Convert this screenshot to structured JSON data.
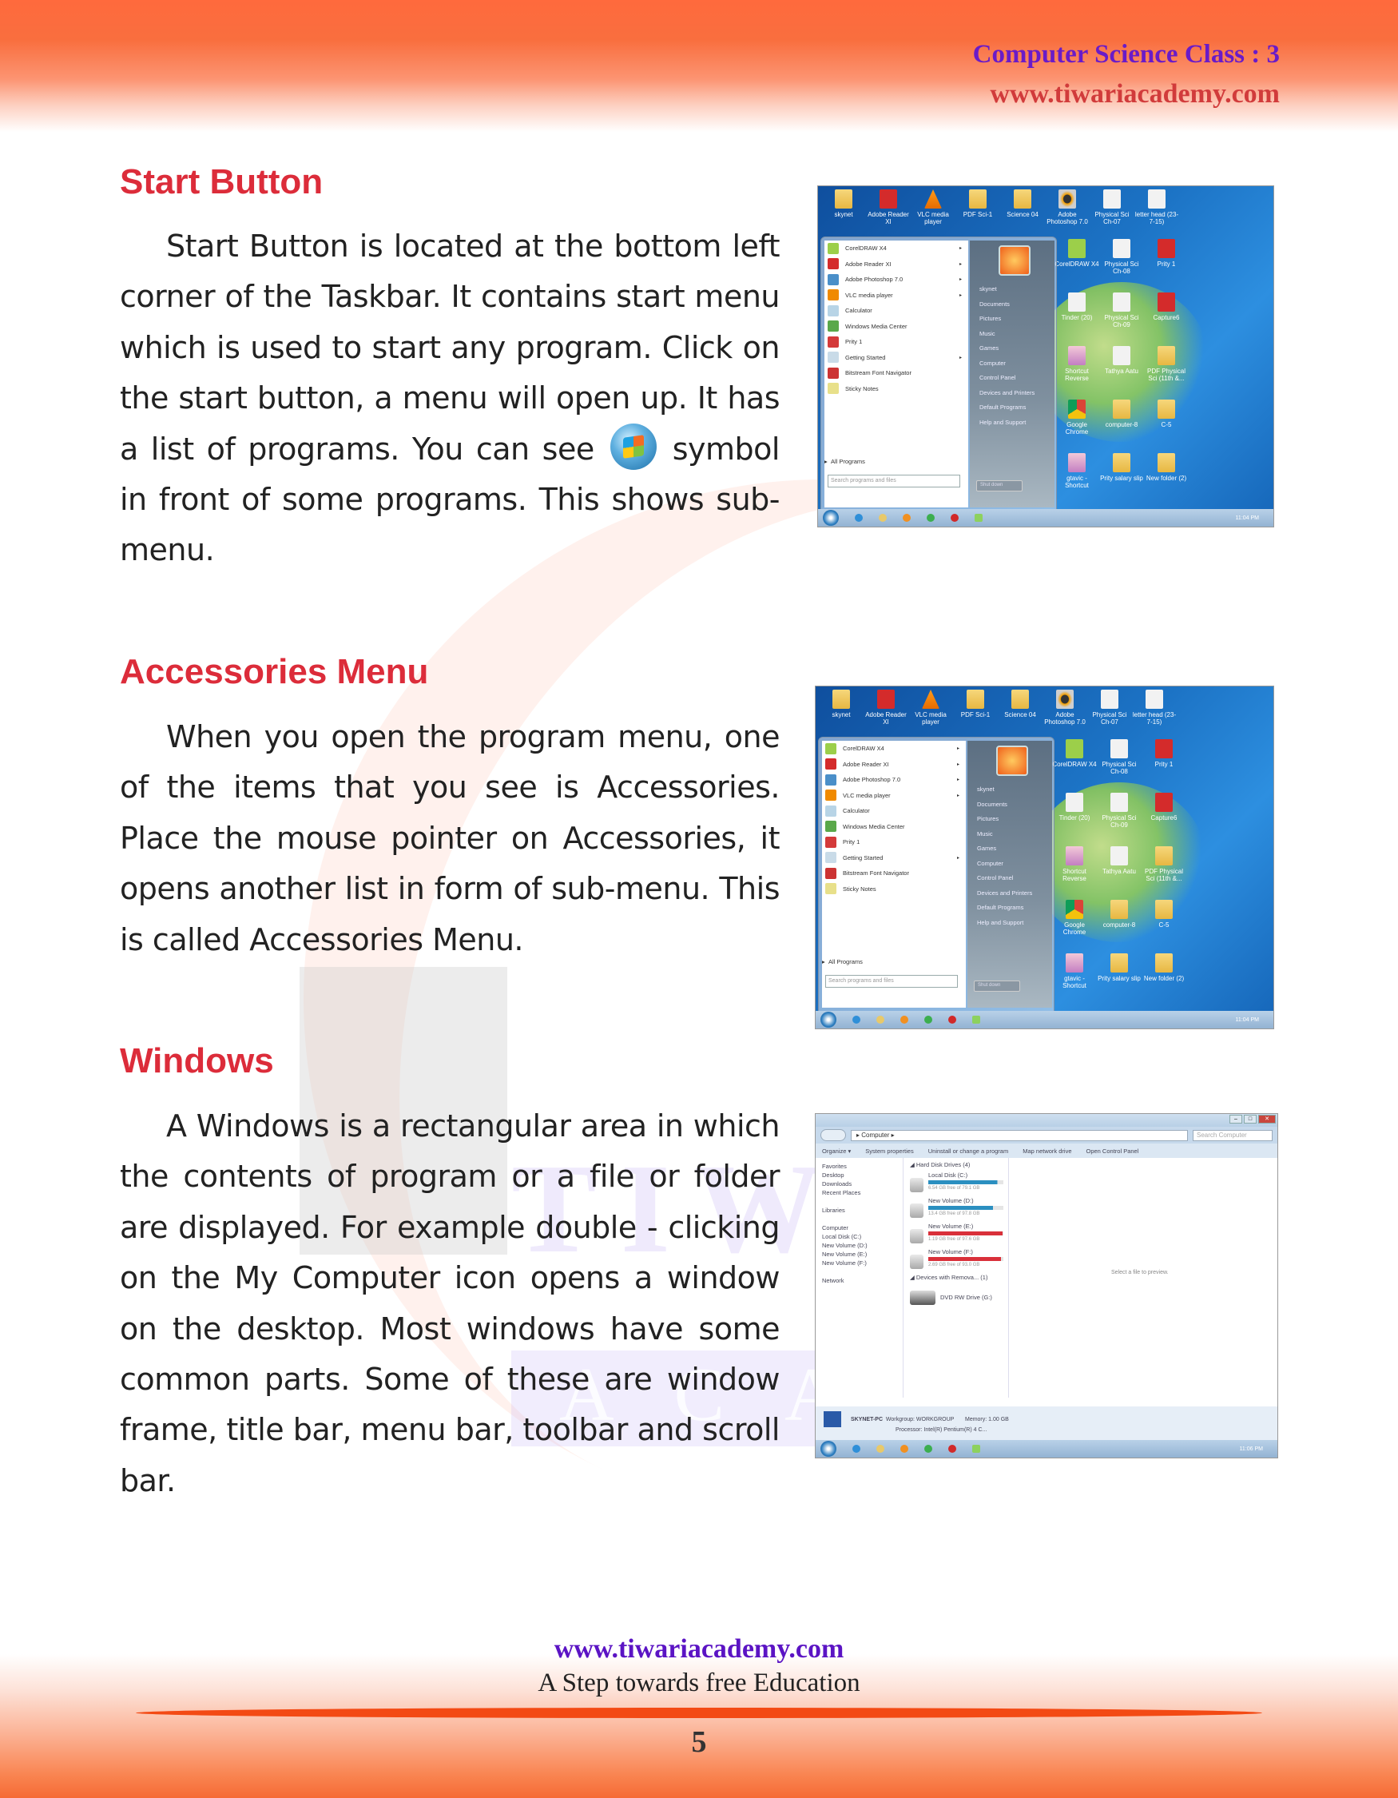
{
  "header": {
    "class_label": "Computer Science Class : 3",
    "website": "www.tiwariacademy.com"
  },
  "watermark": {
    "word_top": "TIWARI",
    "word_bottom": "ACADEMY"
  },
  "sections": [
    {
      "title": "Start Button",
      "paragraph_before_icon": "Start Button is located at the bottom left corner of the Taskbar. It contains start menu which is used to start any program. Click on the start button, a menu will open up. It has a list of programs. You can see",
      "inline_icon": "windows-orb-icon",
      "paragraph_after_icon": "symbol in front of some programs. This shows sub-menu."
    },
    {
      "title": "Accessories Menu",
      "paragraph": "When you open the program menu, one of the items that you see is Accessories. Place the  mouse  pointer on Accessories, it opens another list in form of sub-menu. This is called Accessories Menu."
    },
    {
      "title": "Windows",
      "paragraph": "A Windows is a rectangular area in which the contents of program or a file or folder are displayed. For example double - clicking on the My Computer icon opens  a window on the desktop. Most windows have some common parts. Some of these are window frame, title bar, menu bar, toolbar and scroll bar."
    }
  ],
  "start_menu_screenshot": {
    "desktop_icons_top": [
      {
        "label": "skynet",
        "icon": "folder"
      },
      {
        "label": "Adobe Reader XI",
        "icon": "red"
      },
      {
        "label": "VLC media player",
        "icon": "vlc"
      },
      {
        "label": "PDF Sci-1",
        "icon": "folder"
      },
      {
        "label": "Science 04",
        "icon": "folder"
      },
      {
        "label": "Adobe Photoshop 7.0",
        "icon": "ps"
      },
      {
        "label": "Physical Sci Ch-07",
        "icon": "doc"
      },
      {
        "label": "letter head (23-7-15)",
        "icon": "doc"
      }
    ],
    "desktop_icons_right": [
      [
        "CorelDRAW X4",
        "Physical Sci Ch-08",
        "Prity 1"
      ],
      [
        "Tinder (20)",
        "Physical Sci Ch-09",
        "Capture6"
      ],
      [
        "Shortcut Reverse",
        "Tathya Aatu",
        "PDF Physical Sci (11th &..."
      ],
      [
        "Google Chrome",
        "computer-8",
        "C-5"
      ],
      [
        "gtavic - Shortcut",
        "Prity salary slip",
        "New folder (2)"
      ]
    ],
    "programs": [
      {
        "label": "CorelDRAW X4",
        "submenu": true
      },
      {
        "label": "Adobe Reader XI",
        "submenu": true
      },
      {
        "label": "Adobe Photoshop 7.0",
        "submenu": true
      },
      {
        "label": "VLC media player",
        "submenu": true
      },
      {
        "label": "Calculator",
        "submenu": false
      },
      {
        "label": "Windows Media Center",
        "submenu": false
      },
      {
        "label": "Prity 1",
        "submenu": false
      },
      {
        "label": "Getting Started",
        "submenu": true
      },
      {
        "label": "Bitstream Font Navigator",
        "submenu": false
      },
      {
        "label": "Sticky Notes",
        "submenu": false
      }
    ],
    "all_programs": "All Programs",
    "search_placeholder": "Search programs and files",
    "right_items": [
      "skynet",
      "Documents",
      "Pictures",
      "Music",
      "Games",
      "Computer",
      "Control Panel",
      "Devices and Printers",
      "Default Programs",
      "Help and Support"
    ],
    "shutdown": "Shut down",
    "clock": "11:04 PM"
  },
  "explorer_screenshot": {
    "breadcrumb": "Computer",
    "search_placeholder": "Search Computer",
    "commands": [
      "Organize ▾",
      "System properties",
      "Uninstall or change a program",
      "Map network drive",
      "Open Control Panel"
    ],
    "nav_pane": [
      "Favorites",
      "Desktop",
      "Downloads",
      "Recent Places",
      "",
      "Libraries",
      "",
      "Computer",
      "Local Disk (C:)",
      "New Volume (D:)",
      "New Volume (E:)",
      "New Volume (F:)",
      "",
      "Network"
    ],
    "group_hdd": "Hard Disk Drives (4)",
    "drives": [
      {
        "name": "Local Disk (C:)",
        "free": "6.54 GB free of 79.1 GB",
        "used_fraction": 0.92,
        "color": "#2b8fc0"
      },
      {
        "name": "New Volume (D:)",
        "free": "13.4 GB free of 97.8 GB",
        "used_fraction": 0.86,
        "color": "#2b8fc0"
      },
      {
        "name": "New Volume (E:)",
        "free": "1.19 GB free of 97.6 GB",
        "used_fraction": 0.99,
        "color": "#d9303a"
      },
      {
        "name": "New Volume (F:)",
        "free": "2.69 GB free of 93.0 GB",
        "used_fraction": 0.97,
        "color": "#d9303a"
      }
    ],
    "group_removable": "Devices with Remova... (1)",
    "dvd": "DVD RW Drive (G:)",
    "preview_text": "Select a file to preview.",
    "details": {
      "pc_name": "SKYNET-PC",
      "workgroup": "Workgroup: WORKGROUP",
      "memory": "Memory: 1.00 GB",
      "processor": "Processor: Intel(R) Pentium(R) 4 C..."
    },
    "clock": "11:06 PM"
  },
  "footer": {
    "website": "www.tiwariacademy.com",
    "tagline": "A Step towards free Education",
    "page_number": "5"
  }
}
